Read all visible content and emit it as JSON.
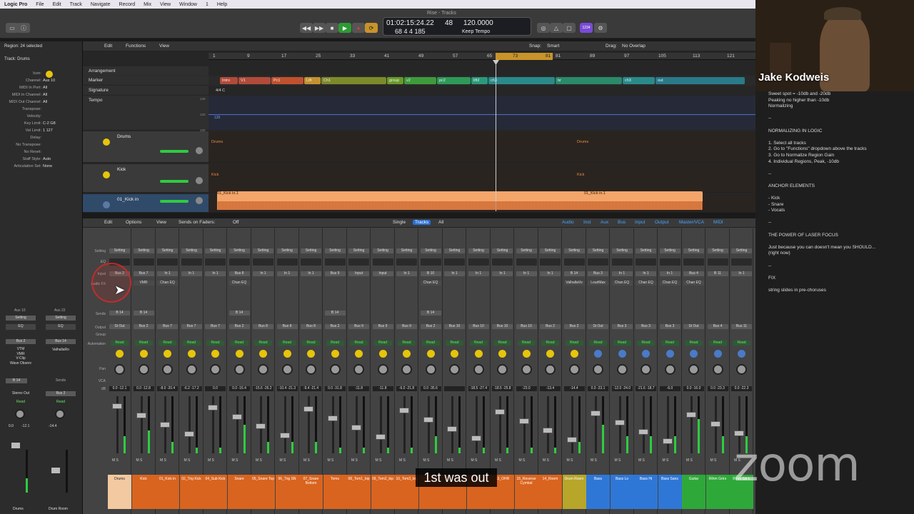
{
  "menubar": {
    "app": "Logic Pro",
    "items": [
      "File",
      "Edit",
      "Track",
      "Navigate",
      "Record",
      "Mix",
      "View",
      "Window",
      "1",
      "Help"
    ]
  },
  "transport": {
    "time": "01:02:15:24.22",
    "bars": "68  4  4  185",
    "tempo_top": "48",
    "tempo": "120.0000",
    "mode": "Keep Tempo",
    "window_title": "Rise - Tracks",
    "badge": "1234"
  },
  "tracks_bar": {
    "edit": "Edit",
    "functions": "Functions",
    "view": "View",
    "snap_label": "Snap:",
    "snap_value": "Smart",
    "drag_label": "Drag:",
    "drag_value": "No Overlap"
  },
  "inspector": {
    "region": "Region: 24 selected",
    "track": "Track: Drums",
    "rows": [
      {
        "k": "Icon:",
        "v": ""
      },
      {
        "k": "Channel:",
        "v": "Aux 10"
      },
      {
        "k": "MIDI In Port:",
        "v": "All"
      },
      {
        "k": "MIDI In Channel:",
        "v": "All"
      },
      {
        "k": "MIDI Out Channel:",
        "v": "All"
      },
      {
        "k": "Transpose:",
        "v": ""
      },
      {
        "k": "Velocity:",
        "v": ""
      },
      {
        "k": "Key Limit:",
        "v": "C-2  G8"
      },
      {
        "k": "Vel Limit:",
        "v": "1  127"
      },
      {
        "k": "Delay:",
        "v": ""
      },
      {
        "k": "No Transpose:",
        "v": ""
      },
      {
        "k": "No Reset:",
        "v": ""
      },
      {
        "k": "Staff Style:",
        "v": "Auto"
      },
      {
        "k": "Articulation Set:",
        "v": "None"
      }
    ],
    "left_strip": {
      "top": "Aux 10",
      "setting": "Setting",
      "eq": "EQ",
      "input": "Bus 2",
      "fx": [
        "VTM",
        "VMR",
        "V-Clip",
        "Wave Observ"
      ],
      "send": "B 14",
      "output": "Stereo Out",
      "auto": "Read",
      "vol": "0.0",
      "peak": "-12.1",
      "name": "Drums"
    },
    "right_strip": {
      "top": "Aux 22",
      "setting": "Setting",
      "eq": "EQ",
      "input": "Bus 14",
      "fx": [
        "ValhallaRo"
      ],
      "send": "Sends",
      "output": "Bus 2",
      "auto": "Read",
      "vol": "-14.4",
      "name": "Drum Room"
    }
  },
  "global_tracks": [
    "Arrangement",
    "Marker",
    "Signature",
    "Tempo"
  ],
  "ruler": [
    "1",
    "9",
    "17",
    "25",
    "33",
    "41",
    "49",
    "57",
    "65",
    "73",
    "81",
    "89",
    "97",
    "105",
    "113",
    "121"
  ],
  "locator": {
    "left": "73",
    "right": "81"
  },
  "arrangement": [
    {
      "label": "Intro",
      "color": "#b24a3a"
    },
    {
      "label": "V1",
      "color": "#b24a3a"
    },
    {
      "label": "Pc1",
      "color": "#c0512f"
    },
    {
      "label": "Lift",
      "color": "#c29130"
    },
    {
      "label": "Ch1",
      "color": "#7d8a2a"
    },
    {
      "label": "group",
      "color": "#6a9a2a"
    },
    {
      "label": "v2",
      "color": "#3f9a3c"
    },
    {
      "label": "pc2",
      "color": "#2e9a57"
    },
    {
      "label": "lift2",
      "color": "#2a9a7a"
    },
    {
      "label": "ch3",
      "color": "#2a8a8a"
    },
    {
      "label": "br",
      "color": "#2a8a6a"
    },
    {
      "label": "ch3",
      "color": "#2a8a8a"
    },
    {
      "label": "out",
      "color": "#2a7a8a"
    }
  ],
  "signature_value": "4/4  C",
  "tempo_marks": [
    "140",
    "120",
    "100"
  ],
  "tempo_value": "120",
  "track_headers": [
    {
      "name": "Drums",
      "region": "Drums",
      "region2": "Drums"
    },
    {
      "name": "Kick",
      "region": "Kick",
      "region2": "Kick"
    },
    {
      "name": "01_Kick in",
      "region": "01_Kick in.1",
      "region2": "01_Kick in.1"
    }
  ],
  "mixer_bar": {
    "edit": "Edit",
    "options": "Options",
    "view": "View",
    "sends": "Sends on Faders:",
    "sends_val": "Off",
    "single": "Single",
    "tracks": "Tracks",
    "all": "All",
    "filters": [
      "Audio",
      "Inst",
      "Aux",
      "Bus",
      "Input",
      "Output",
      "Master/VCA",
      "MIDI"
    ]
  },
  "mixer_rows": [
    "Setting",
    "EQ",
    "Input",
    "Audio FX",
    "Sends",
    "Output",
    "Group",
    "Automation",
    "Pan",
    "VCA",
    "dB"
  ],
  "strips": [
    {
      "input": "Bus 2",
      "fx": "",
      "send": "B 14",
      "output": "St Out",
      "vol": "0.0",
      "peak": "-12.1",
      "name": "Drums",
      "color": "#f2c9a0",
      "level": 0.3
    },
    {
      "input": "Bus 7",
      "fx": "VMR",
      "send": "B 14",
      "output": "Bus 2",
      "vol": "0.0",
      "peak": "-12.8",
      "name": "Kick",
      "color": "#d9641f",
      "level": 0.4
    },
    {
      "input": "In 1",
      "fx": "Chan EQ",
      "send": "",
      "output": "Bus 7",
      "vol": "-8.0",
      "peak": "-20.4",
      "name": "01_Kick in",
      "color": "#d9641f",
      "level": 0.2
    },
    {
      "input": "In 1",
      "fx": "",
      "send": "",
      "output": "Bus 7",
      "vol": "-6.2",
      "peak": "-17.2",
      "name": "02_Trig Kick",
      "color": "#d9641f",
      "level": 0.1
    },
    {
      "input": "In 1",
      "fx": "",
      "send": "",
      "output": "Bus 7",
      "vol": "0.0",
      "peak": "",
      "name": "04_Sub Kick",
      "color": "#d9641f",
      "level": 0.1
    },
    {
      "input": "Bus 8",
      "fx": "Chan EQ",
      "send": "B 14",
      "output": "Bus 2",
      "vol": "0.0",
      "peak": "-16.4",
      "name": "Snare",
      "color": "#d9641f",
      "level": 0.5
    },
    {
      "input": "In 1",
      "fx": "",
      "send": "",
      "output": "Bus 8",
      "vol": "-15.6",
      "peak": "-26.2",
      "name": "05_Snare Top",
      "color": "#d9641f",
      "level": 0.2
    },
    {
      "input": "In 1",
      "fx": "",
      "send": "",
      "output": "Bus 8",
      "vol": "-10.4",
      "peak": "-21.3",
      "name": "06_Trig SN",
      "color": "#d9641f",
      "level": 0.2
    },
    {
      "input": "In 1",
      "fx": "",
      "send": "",
      "output": "Bus 8",
      "vol": "-9.4",
      "peak": "-21.4",
      "name": "07_Snare Bottom",
      "color": "#d9641f",
      "level": 0.2
    },
    {
      "input": "Bus 9",
      "fx": "",
      "send": "B 14",
      "output": "Bus 2",
      "vol": "0.0",
      "peak": "-31.8",
      "name": "Toms",
      "color": "#d9641f",
      "level": 0.1
    },
    {
      "input": "Input",
      "fx": "",
      "send": "",
      "output": "Bus 9",
      "vol": "",
      "peak": "-11.8",
      "name": "08_Tom1_bip",
      "color": "#d9641f",
      "level": 0.1
    },
    {
      "input": "Input",
      "fx": "",
      "send": "",
      "output": "Bus 9",
      "vol": "",
      "peak": "-11.8",
      "name": "09_Tom2_bip",
      "color": "#d9641f",
      "level": 0.1
    },
    {
      "input": "In 1",
      "fx": "",
      "send": "",
      "output": "Bus 9",
      "vol": "-6.0",
      "peak": "-21.8",
      "name": "10_Tom3_bip",
      "color": "#d9641f",
      "level": 0.1
    },
    {
      "input": "B 10",
      "fx": "Chan EQ",
      "send": "B 14",
      "output": "Bus 2",
      "vol": "0.0",
      "peak": "-35.6",
      "name": "",
      "color": "#d9641f",
      "level": 0.3
    },
    {
      "input": "In 1",
      "fx": "",
      "send": "",
      "output": "Bus 10",
      "vol": "",
      "peak": "",
      "name": "",
      "color": "#d9641f",
      "level": 0.1
    },
    {
      "input": "In 1",
      "fx": "",
      "send": "",
      "output": "Bus 10",
      "vol": "-18.5",
      "peak": "-27.4",
      "name": "",
      "color": "#d9641f",
      "level": 0.1
    },
    {
      "input": "In 1",
      "fx": "",
      "send": "",
      "output": "Bus 10",
      "vol": "-18.5",
      "peak": "-25.8",
      "name": "13_OHR",
      "color": "#d9641f",
      "level": 0.1
    },
    {
      "input": "In 1",
      "fx": "",
      "send": "",
      "output": "Bus 10",
      "vol": "-23.0",
      "peak": "",
      "name": "15_Reverse Cymbal",
      "color": "#d9641f",
      "level": 0.1
    },
    {
      "input": "In 1",
      "fx": "",
      "send": "",
      "output": "Bus 2",
      "vol": "-13.4",
      "peak": "",
      "name": "14_Room",
      "color": "#d9641f",
      "level": 0.1
    },
    {
      "input": "B 14",
      "fx": "ValhallaVo",
      "send": "",
      "output": "Bus 2",
      "vol": "-14.4",
      "peak": "",
      "name": "Drum Room",
      "color": "#b7a62a",
      "level": 0.2
    },
    {
      "input": "Bus 3",
      "fx": "LoudMax",
      "send": "",
      "output": "St Out",
      "vol": "0.0",
      "peak": "-23.1",
      "name": "Bass",
      "color": "#2f77d6",
      "level": 0.5
    },
    {
      "input": "In 1",
      "fx": "Chan EQ",
      "send": "",
      "output": "Bus 3",
      "vol": "-12.0",
      "peak": "-24.0",
      "name": "Bass Lo",
      "color": "#2f77d6",
      "level": 0.3
    },
    {
      "input": "In 1",
      "fx": "Chan EQ",
      "send": "",
      "output": "Bus 3",
      "vol": "-21.6",
      "peak": "-18.7",
      "name": "Bass Hi",
      "color": "#2f77d6",
      "level": 0.3
    },
    {
      "input": "In 1",
      "fx": "Chan EQ",
      "send": "",
      "output": "Bus 3",
      "vol": "-6.0",
      "peak": "",
      "name": "Bass Sans",
      "color": "#2f77d6",
      "level": 0.3
    },
    {
      "input": "Bus 4",
      "fx": "Chan EQ",
      "send": "",
      "output": "St Out",
      "vol": "0.0",
      "peak": "-16.0",
      "name": "Guitar",
      "color": "#2fa83a",
      "level": 0.6
    },
    {
      "input": "B 11",
      "fx": "",
      "send": "",
      "output": "Bus 4",
      "vol": "0.0",
      "peak": "-23.3",
      "name": "Rthm Grtrs",
      "color": "#2fa83a",
      "level": 0.3
    },
    {
      "input": "In 1",
      "fx": "",
      "send": "",
      "output": "Bus 11",
      "vol": "0.0",
      "peak": "-22.3",
      "name": "Rthm Gtr L",
      "color": "#2fa83a",
      "level": 0.3
    }
  ],
  "caption": "1st was out",
  "zoom_logo": "zoom",
  "presenter": "Jake Kodweis",
  "notes": [
    "Sweet spot = -10db and -20db",
    "Peaking no higher than -10db",
    "Normalizing",
    "",
    "--",
    "",
    "NORMALIZING IN LOGIC",
    "",
    "1. Select all tracks",
    "2. Go to \"Functions\" dropdown above the tracks",
    "3. Go to Normalize Region Gain",
    "4. Individual Regions, Peak, -10db",
    "",
    "--",
    "",
    "ANCHOR ELEMENTS",
    "",
    "- Kick",
    "- Snare",
    "- Vocals",
    "",
    "--",
    "",
    "THE POWER OF LASER FOCUS",
    "",
    "Just because you can doesn't mean you SHOULD...",
    "(right now)",
    "",
    "--",
    "",
    "FIX",
    "",
    "string slides in pre-choruses"
  ]
}
